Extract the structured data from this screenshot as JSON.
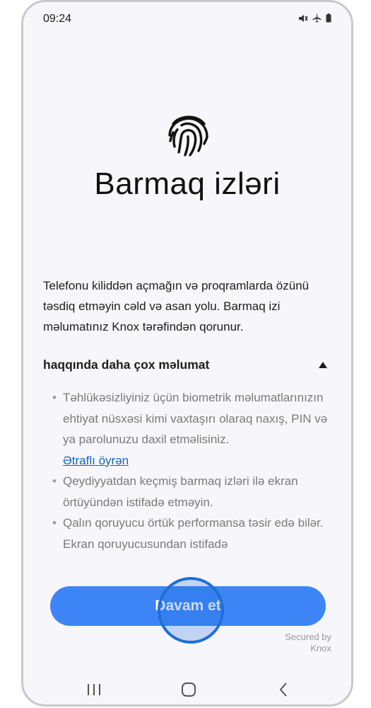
{
  "status_bar": {
    "time": "09:24",
    "icons": [
      "mute-icon",
      "airplane-icon",
      "battery-icon"
    ]
  },
  "main": {
    "title": "Barmaq izləri",
    "description": "Telefonu kiliddən açmağın və proqramlarda özünü təsdiq etməyin cəld və asan yolu. Barmaq izi məlumatınız Knox tərəfindən qorunur.",
    "more_info": {
      "label": "haqqında daha çox məlumat",
      "tips": [
        "Təhlükəsizliyiniz üçün biometrik məlumatlarınızın ehtiyat nüsxəsi kimi vaxtaşırı olaraq naxış, PIN və ya parolunuzu daxil etməlisiniz.",
        "Qeydiyyatdan keçmiş barmaq izləri ilə ekran örtüyündən istifadə etməyin.",
        "Qalın qoruyucu örtük performansa təsir edə bilər. Ekran qoruyucusundan istifadə"
      ],
      "learn_more_link": "Ətraflı öyrən"
    },
    "continue_button": "Davam et",
    "secured_by": [
      "Secured by",
      "Knox"
    ]
  },
  "colors": {
    "accent": "#3d85f7",
    "link": "#1565c0",
    "tap_ring": "#1f6fd6"
  },
  "nav_bar": [
    "recents-icon",
    "home-icon",
    "back-icon"
  ]
}
